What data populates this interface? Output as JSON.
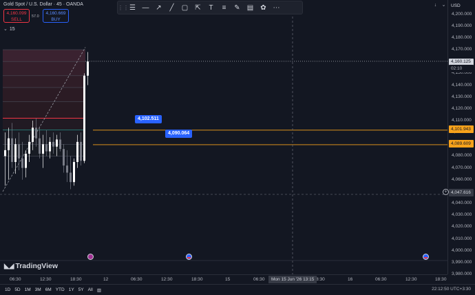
{
  "header": {
    "symbol": "Gold Spot / U.S. Dollar · 45 · OANDA",
    "sell_price": "4,160.099",
    "sell_label": "SELL",
    "spread": "57.0",
    "buy_price": "4,160.669",
    "buy_label": "BUY",
    "timeframe": "15"
  },
  "toolbar": {
    "icons": [
      "drag-handle-icon",
      "hlines-icon",
      "horizontal-line-icon",
      "trend-line-icon",
      "diagonal-line-icon",
      "rectangle-icon",
      "arrow-marker-icon",
      "text-icon",
      "fib-icon",
      "pencil-icon",
      "ruler-icon",
      "palette-icon",
      "more-icon"
    ]
  },
  "price_axis": {
    "currency": "USD",
    "ticks": [
      "4,200.000",
      "4,190.000",
      "4,180.000",
      "4,170.000",
      "4,160.000",
      "4,150.000",
      "4,140.000",
      "4,130.000",
      "4,120.000",
      "4,110.000",
      "4,100.000",
      "4,090.000",
      "4,080.000",
      "4,070.000",
      "4,060.000",
      "4,050.000",
      "4,040.000",
      "4,030.000",
      "4,020.000",
      "4,010.000",
      "4,000.000",
      "3,990.000",
      "3,980.000"
    ],
    "tags": {
      "last_price": "4,160.125",
      "countdown": "02:10",
      "alert_upper": "4,101.943",
      "alert_lower": "4,089.609",
      "crosshair": "4,047.616"
    }
  },
  "alerts": {
    "upper_label": "4,102.511",
    "lower_label": "4,090.064"
  },
  "time_axis": {
    "labels": [
      "06:30",
      "12:30",
      "18:30",
      "12",
      "06:30",
      "12:30",
      "18:30",
      "15",
      "06:30",
      "8:30",
      "16",
      "06:30",
      "12:30",
      "18:30"
    ],
    "crosshair_date": "Mon 15 Jun '26",
    "crosshair_time": "13:15"
  },
  "bottom_bar": {
    "ranges": [
      "1D",
      "5D",
      "1M",
      "3M",
      "6M",
      "YTD",
      "1Y",
      "5Y",
      "All"
    ],
    "range_icon": "calendar-range-icon",
    "clock": "22:12:50 UTC+3:30"
  },
  "logo_text": "TradingView",
  "colors": {
    "background": "#131722",
    "up_candle": "#ffffff",
    "down_candle": "#787b86",
    "alert_line": "#f7a21b",
    "alert_label": "#2962ff",
    "sell": "#f23645",
    "buy": "#2962ff"
  },
  "chart_data": {
    "type": "candlestick",
    "price_range": [
      3980,
      4205
    ],
    "candles": [
      {
        "o": 4080,
        "h": 4100,
        "l": 4055,
        "c": 4085
      },
      {
        "o": 4085,
        "h": 4104,
        "l": 4060,
        "c": 4095
      },
      {
        "o": 4095,
        "h": 4108,
        "l": 4070,
        "c": 4075
      },
      {
        "o": 4075,
        "h": 4095,
        "l": 4065,
        "c": 4090
      },
      {
        "o": 4090,
        "h": 4100,
        "l": 4068,
        "c": 4078
      },
      {
        "o": 4078,
        "h": 4092,
        "l": 4060,
        "c": 4070
      },
      {
        "o": 4070,
        "h": 4085,
        "l": 4062,
        "c": 4082
      },
      {
        "o": 4082,
        "h": 4098,
        "l": 4075,
        "c": 4092
      },
      {
        "o": 4092,
        "h": 4110,
        "l": 4085,
        "c": 4104
      },
      {
        "o": 4104,
        "h": 4112,
        "l": 4088,
        "c": 4095
      },
      {
        "o": 4095,
        "h": 4105,
        "l": 4078,
        "c": 4082
      },
      {
        "o": 4082,
        "h": 4098,
        "l": 4070,
        "c": 4090
      },
      {
        "o": 4090,
        "h": 4102,
        "l": 4080,
        "c": 4084
      },
      {
        "o": 4084,
        "h": 4096,
        "l": 4078,
        "c": 4092
      },
      {
        "o": 4092,
        "h": 4100,
        "l": 4082,
        "c": 4088
      },
      {
        "o": 4088,
        "h": 4098,
        "l": 4080,
        "c": 4094
      },
      {
        "o": 4094,
        "h": 4100,
        "l": 4084,
        "c": 4086
      },
      {
        "o": 4086,
        "h": 4090,
        "l": 4066,
        "c": 4072
      },
      {
        "o": 4072,
        "h": 4085,
        "l": 4058,
        "c": 4066
      },
      {
        "o": 4066,
        "h": 4080,
        "l": 4052,
        "c": 4058
      },
      {
        "o": 4058,
        "h": 4078,
        "l": 4055,
        "c": 4075
      },
      {
        "o": 4075,
        "h": 4098,
        "l": 4070,
        "c": 4092
      },
      {
        "o": 4092,
        "h": 4100,
        "l": 4072,
        "c": 4076
      },
      {
        "o": 4076,
        "h": 4150,
        "l": 4074,
        "c": 4148
      },
      {
        "o": 4148,
        "h": 4168,
        "l": 4140,
        "c": 4160
      }
    ],
    "horizontal_lines": [
      4101.943,
      4089.609
    ],
    "crosshair_price": 4047.616
  }
}
